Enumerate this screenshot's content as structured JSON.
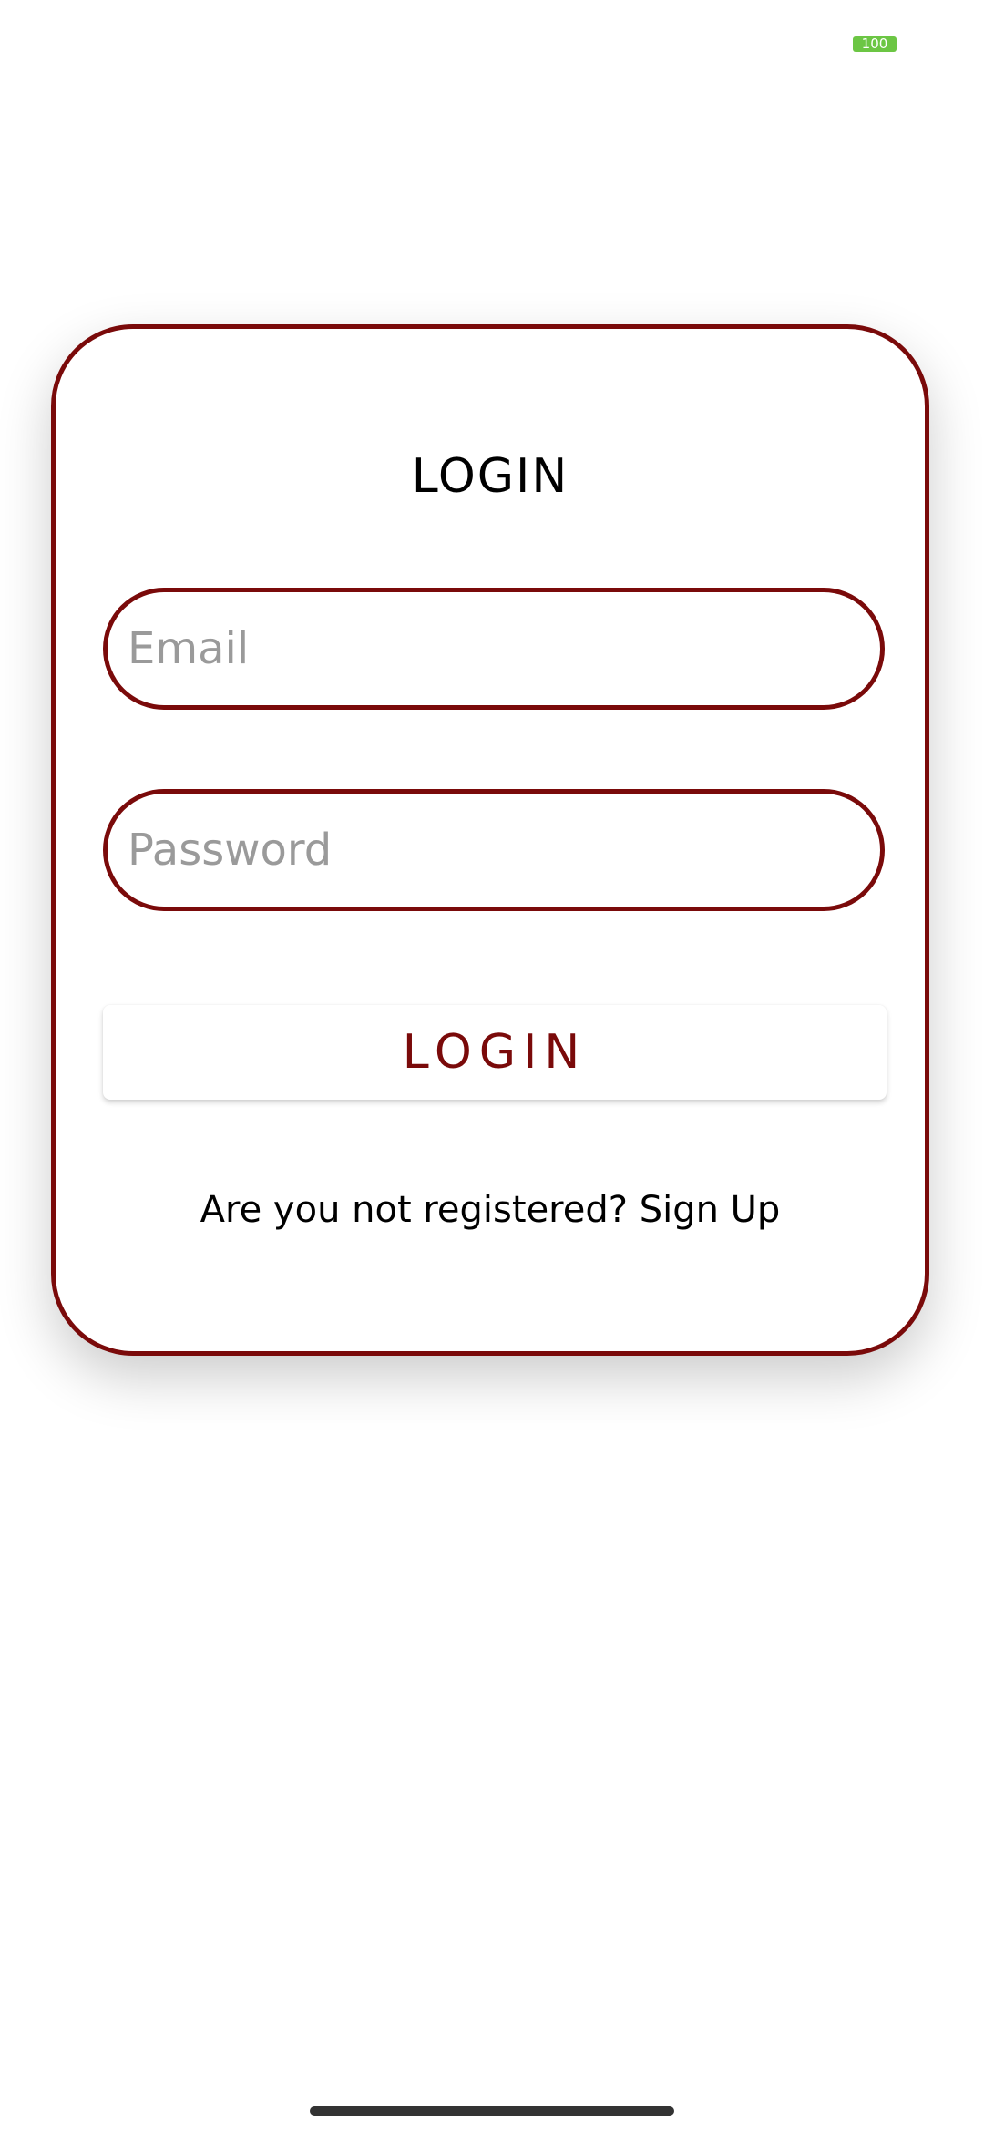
{
  "status_bar": {
    "battery_level": "100",
    "battery_color": "#6cc644"
  },
  "login_card": {
    "title": "LOGIN",
    "email": {
      "placeholder": "Email",
      "value": ""
    },
    "password": {
      "placeholder": "Password",
      "value": ""
    },
    "login_button_label": "LOGIN",
    "signup_prompt": "Are you not registered? ",
    "signup_link": "Sign Up"
  },
  "colors": {
    "accent": "#7a0a0a",
    "placeholder": "#9a9a9a",
    "background": "#ffffff"
  }
}
